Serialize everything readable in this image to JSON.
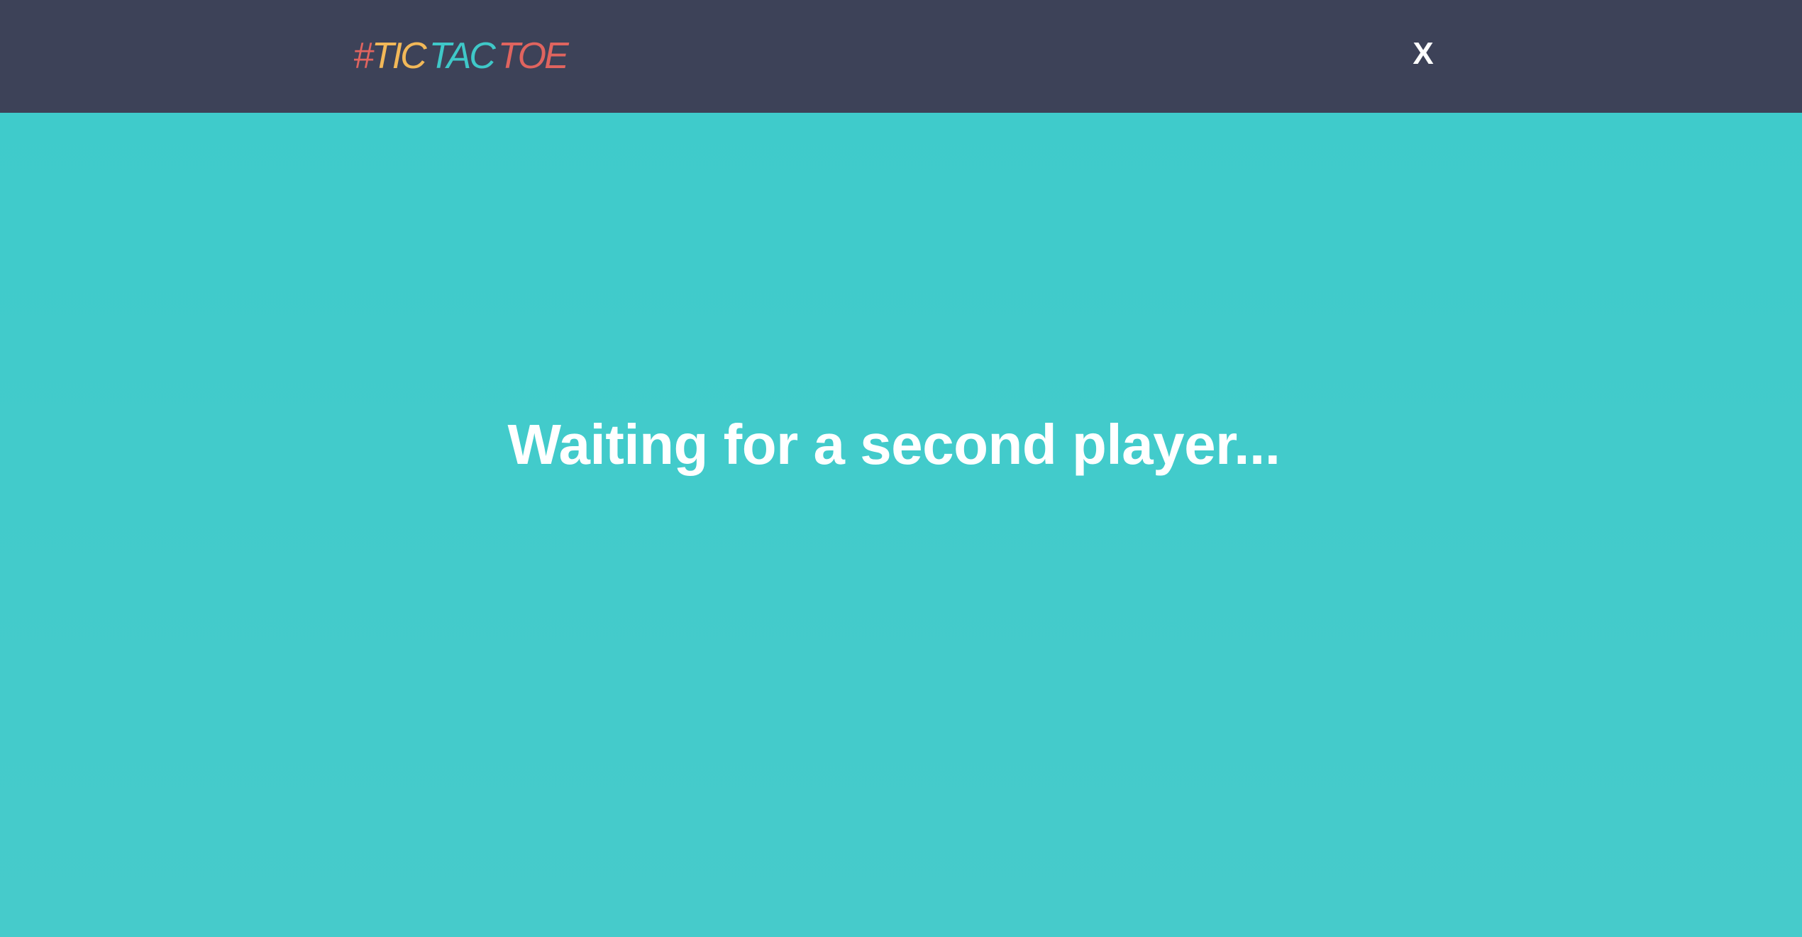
{
  "header": {
    "logo": {
      "hash": "#",
      "tic": "TIC",
      "tac": "TAC",
      "toe": "TOE",
      "colors": {
        "hash": "#e0645f",
        "tic": "#f2b858",
        "tac": "#3fc8c8",
        "toe": "#e0645f"
      }
    },
    "close_label": "X"
  },
  "main": {
    "status_text": "Waiting for a second player...",
    "background_color": "#42cbcb"
  },
  "theme": {
    "topbar_color": "#3d4258",
    "text_color": "#ffffff"
  }
}
